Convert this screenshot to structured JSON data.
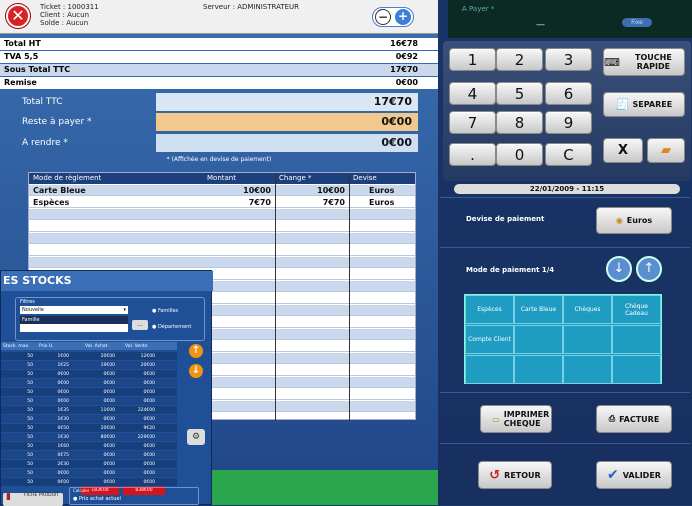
{
  "header": {
    "ticket": "Ticket : 1000311",
    "client": "Client : Aucun",
    "solde": "Solde : Aucun",
    "serveur": "Serveur : ADMINISTRATEUR",
    "close_icon": "close-icon",
    "minus": "−",
    "plus": "+"
  },
  "totals": [
    {
      "label": "Total HT",
      "value": "16€78"
    },
    {
      "label": "TVA 5,5",
      "value": "0€92"
    },
    {
      "label": "Sous Total TTC",
      "value": "17€70"
    },
    {
      "label": "Remise",
      "value": "0€00"
    }
  ],
  "summary": {
    "total_ttc_label": "Total TTC",
    "total_ttc_value": "17€70",
    "reste_label": "Reste à payer *",
    "reste_value": "0€00",
    "rendre_label": "A rendre *",
    "rendre_value": "0€00",
    "note": "* (Affichée en devise de paiement)"
  },
  "payments": {
    "headers": [
      "Mode de règlement",
      "Montant",
      "Change *",
      "Devise"
    ],
    "rows": [
      [
        "Carte Bleue",
        "10€00",
        "10€00",
        "Euros"
      ],
      [
        "Espèces",
        "7€70",
        "7€70",
        "Euros"
      ]
    ]
  },
  "stocks": {
    "title": "ES STOCKS",
    "filtre": "Filtres",
    "filter_value": "Nouvelle",
    "famille": "Famille",
    "radio1": "Familles",
    "radio2": "Département",
    "btn": "...",
    "columns": [
      "Stock. max.",
      "Prix U.",
      "Val. Achat",
      "Val. Vente"
    ],
    "rows": [
      [
        "50",
        "1€00",
        "20€00",
        "12€00"
      ],
      [
        "50",
        "1€25",
        "19€00",
        "20€00"
      ],
      [
        "50",
        "0€00",
        "0€00",
        "0€00"
      ],
      [
        "50",
        "0€00",
        "0€00",
        "0€00"
      ],
      [
        "50",
        "0€00",
        "0€00",
        "0€00"
      ],
      [
        "50",
        "0€00",
        "0€00",
        "0€00"
      ],
      [
        "50",
        "1€35",
        "11€00",
        "224€00"
      ],
      [
        "50",
        "1€30",
        "0€00",
        "0€00"
      ],
      [
        "50",
        "0€50",
        "20€00",
        "9€20"
      ],
      [
        "50",
        "1€30",
        "80€00",
        "229€00"
      ],
      [
        "50",
        "1€60",
        "0€00",
        "0€00"
      ],
      [
        "50",
        "0€75",
        "0€00",
        "0€00"
      ],
      [
        "50",
        "2€30",
        "0€00",
        "0€00"
      ],
      [
        "50",
        "0€00",
        "0€00",
        "0€00"
      ],
      [
        "50",
        "0€00",
        "0€00",
        "0€00"
      ]
    ],
    "total_achat": "183€00",
    "total_vente": "838€00",
    "fiche": "FICHE PRODUIT",
    "calc_label": "Calculer",
    "calc_option": "Prix achat actuel"
  },
  "display": {
    "label": "A Payer *",
    "value": "—",
    "fixe": "Fixe"
  },
  "keypad": {
    "keys": [
      "1",
      "2",
      "3",
      "4",
      "5",
      "6",
      "7",
      "8",
      "9",
      ".",
      "0",
      "C"
    ],
    "touche_rapide": "TOUCHE RAPIDE",
    "separee": "SEPAREE",
    "x": "X"
  },
  "date": "22/01/2009 - 11:15",
  "devise": {
    "label": "Devise de paiement",
    "value": "Euros"
  },
  "mode": {
    "label": "Mode de paiement 1/4",
    "cells": [
      "Espèces",
      "Carte Bleue",
      "Chèques",
      "Chèque Cadeau",
      "Compte Client",
      "",
      "",
      "",
      "",
      "",
      "",
      ""
    ]
  },
  "buttons": {
    "imprimer": "IMPRIMER CHEQUE",
    "facture": "FACTURE",
    "retour": "RETOUR",
    "valider": "VALIDER"
  },
  "colors": {
    "accent_green": "#2aa64c",
    "panel_blue": "#21488a",
    "payment_teal": "#1f9cc2",
    "highlight": "#f2c98c"
  }
}
